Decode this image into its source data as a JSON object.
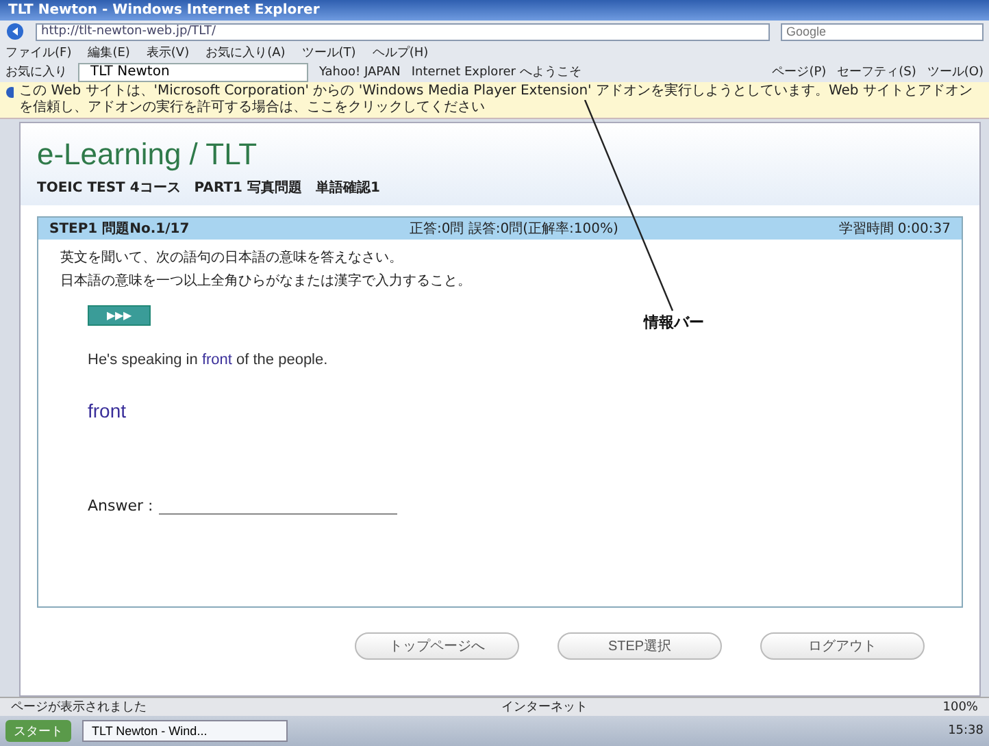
{
  "window": {
    "title": "TLT Newton - Windows Internet Explorer"
  },
  "address_bar": {
    "url": "http://tlt-newton-web.jp/TLT/",
    "search_placeholder": "Google"
  },
  "menu": [
    "ファイル(F)",
    "編集(E)",
    "表示(V)",
    "お気に入り(A)",
    "ツール(T)",
    "ヘルプ(H)"
  ],
  "favorites_bar": {
    "favorites": "お気に入り",
    "tabs": [
      {
        "label": "TLT Newton",
        "selected": true
      }
    ],
    "links": [
      "Yahoo! JAPAN",
      "Internet Explorer へようこそ"
    ],
    "commands": [
      "ページ(P)",
      "セーフティ(S)",
      "ツール(O)"
    ]
  },
  "info_bar": {
    "message": "この Web サイトは、'Microsoft Corporation' からの 'Windows Media Player Extension' アドオンを実行しようとしています。Web サイトとアドオンを信頼し、アドオンの実行を許可する場合は、ここをクリックしてください"
  },
  "page": {
    "logo": "e-Learning / TLT",
    "breadcrumb": "TOEIC TEST 4コース　PART1 写真問題　単語確認1",
    "step_bar": {
      "step": "STEP1 問題No.1/17",
      "score": "正答:0問 誤答:0問(正解率:100%)",
      "time": "学習時間 0:00:37"
    },
    "instructions": [
      "英文を聞いて、次の語句の日本語の意味を答えなさい。",
      "日本語の意味を一つ以上全角ひらがなまたは漢字で入力すること。"
    ],
    "play_button": "▶▶▶",
    "sentence": {
      "before": "He's speaking in ",
      "highlight": "front",
      "after": " of the people."
    },
    "word": "front",
    "answer_label": "Answer :",
    "buttons": [
      "トップページへ",
      "STEP選択",
      "ログアウト"
    ]
  },
  "annotation": {
    "label": "情報バー"
  },
  "status_bar": {
    "message": "ページが表示されました",
    "zone": "インターネット",
    "zoom": "100%"
  },
  "taskbar": {
    "start": "スタート",
    "items": [
      {
        "label": "TLT Newton - Wind...",
        "selected": true
      }
    ],
    "clock": "15:38"
  }
}
